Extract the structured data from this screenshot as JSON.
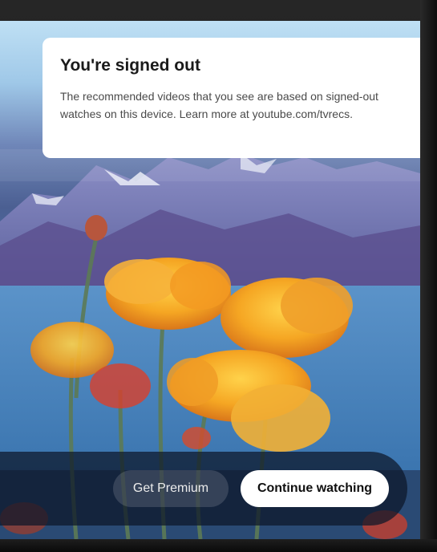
{
  "dialog": {
    "title": "You're signed out",
    "body": "The recommended videos that you see are based on signed-out watches on this device. Learn more at youtube.com/tvrecs."
  },
  "actions": {
    "premium_label": "Get Premium",
    "continue_label": "Continue watching"
  },
  "colors": {
    "card_background": "#ffffff",
    "primary_button": "#ffffff",
    "secondary_button_text": "#ececec"
  }
}
